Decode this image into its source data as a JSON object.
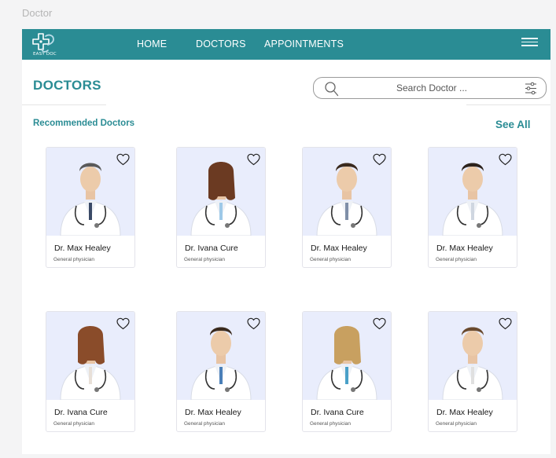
{
  "frame_label": "Doctor",
  "navbar": {
    "logo_text": "EASY DOC",
    "links": [
      "HOME",
      "DOCTORS",
      "APPOINTMENTS"
    ]
  },
  "page": {
    "title": "DOCTORS",
    "section_label": "Recommended Doctors",
    "see_all": "See All"
  },
  "search": {
    "placeholder": "Search Doctor ..."
  },
  "colors": {
    "brand": "#2a8c94",
    "card_photo_bg": "#e9edfc",
    "white": "#ffffff"
  },
  "icons": {
    "logo": "plus-cross-logo-icon",
    "menu": "hamburger-menu-icon",
    "search": "search-icon",
    "filter": "filter-sliders-icon",
    "favorite": "heart-icon"
  },
  "doctors": [
    {
      "name": "Dr. Max Healey",
      "specialty": "General physician",
      "coat": "#ffffff",
      "hair": "#5a5a5a",
      "tie": "#3a4a66",
      "gender": "male"
    },
    {
      "name": "Dr. Ivana Cure",
      "specialty": "General physician",
      "coat": "#ffffff",
      "hair": "#6b3a22",
      "tie": "#9ec9e8",
      "gender": "female"
    },
    {
      "name": "Dr. Max Healey",
      "specialty": "General physician",
      "coat": "#ffffff",
      "hair": "#3a2a1e",
      "tie": "#7f8fa8",
      "gender": "male"
    },
    {
      "name": "Dr. Max Healey",
      "specialty": "General physician",
      "coat": "#ffffff",
      "hair": "#2c221c",
      "tie": "#cfd6e0",
      "gender": "male"
    },
    {
      "name": "Dr. Ivana Cure",
      "specialty": "General physician",
      "coat": "#ffffff",
      "hair": "#8a4c2a",
      "tie": "#e8e0d8",
      "gender": "female"
    },
    {
      "name": "Dr. Max Healey",
      "specialty": "General physician",
      "coat": "#ffffff",
      "hair": "#3a2a1e",
      "tie": "#4a7fb8",
      "gender": "male"
    },
    {
      "name": "Dr. Ivana Cure",
      "specialty": "General physician",
      "coat": "#ffffff",
      "hair": "#c8a060",
      "tie": "#4aa0c8",
      "gender": "female"
    },
    {
      "name": "Dr. Max Healey",
      "specialty": "General physician",
      "coat": "#ffffff",
      "hair": "#6a4a2e",
      "tie": "#e0e0e0",
      "gender": "male"
    }
  ]
}
